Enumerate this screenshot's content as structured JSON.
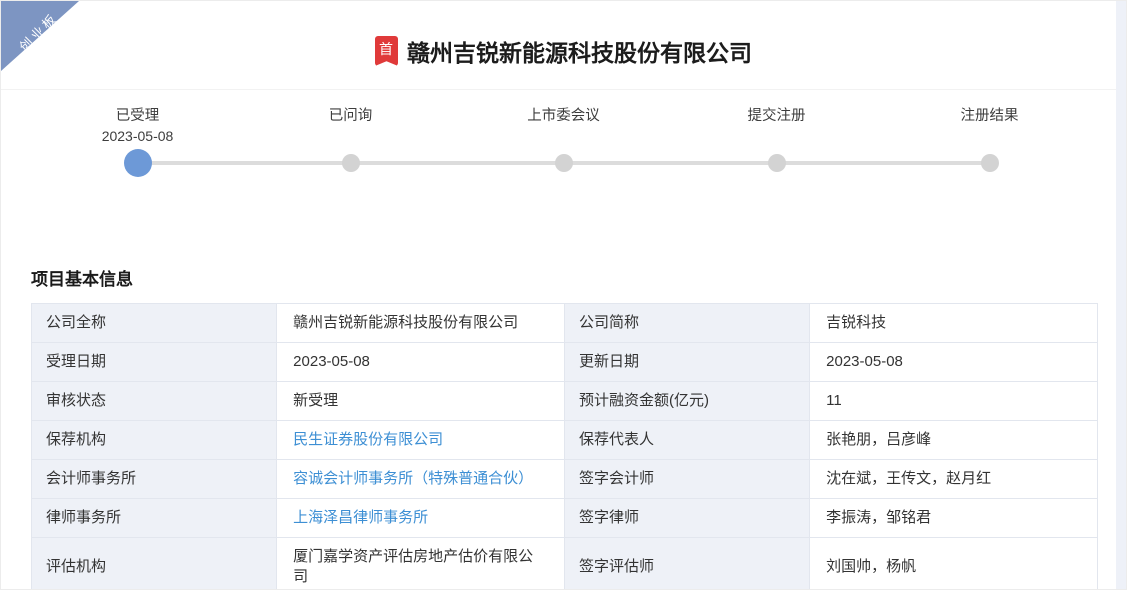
{
  "ribbon": {
    "label": "创业板",
    "color": "#7d95c2"
  },
  "header": {
    "badge_label": "首",
    "badge_color": "#e03a3a",
    "title": "赣州吉锐新能源科技股份有限公司"
  },
  "timeline": {
    "active_color": "#6d99d7",
    "inactive_color": "#d3d3d3",
    "steps": [
      {
        "label": "已受理",
        "date": "2023-05-08",
        "active": true
      },
      {
        "label": "已问询",
        "date": "",
        "active": false
      },
      {
        "label": "上市委会议",
        "date": "",
        "active": false
      },
      {
        "label": "提交注册",
        "date": "",
        "active": false
      },
      {
        "label": "注册结果",
        "date": "",
        "active": false
      }
    ]
  },
  "section": {
    "title": "项目基本信息"
  },
  "info_table": {
    "link_color": "#3d8fd4",
    "rows": [
      {
        "label1": "公司全称",
        "value1": "赣州吉锐新能源科技股份有限公司",
        "link1": false,
        "label2": "公司简称",
        "value2": "吉锐科技"
      },
      {
        "label1": "受理日期",
        "value1": "2023-05-08",
        "link1": false,
        "label2": "更新日期",
        "value2": "2023-05-08"
      },
      {
        "label1": "审核状态",
        "value1": "新受理",
        "link1": false,
        "label2": "预计融资金额(亿元)",
        "value2": "11"
      },
      {
        "label1": "保荐机构",
        "value1": "民生证券股份有限公司",
        "link1": true,
        "label2": "保荐代表人",
        "value2": "张艳朋，吕彦峰"
      },
      {
        "label1": "会计师事务所",
        "value1": "容诚会计师事务所（特殊普通合伙）",
        "link1": true,
        "label2": "签字会计师",
        "value2": "沈在斌，王传文，赵月红"
      },
      {
        "label1": "律师事务所",
        "value1": "上海泽昌律师事务所",
        "link1": true,
        "label2": "签字律师",
        "value2": "李振涛，邹铭君"
      },
      {
        "label1": "评估机构",
        "value1": "厦门嘉学资产评估房地产估价有限公司",
        "link1": false,
        "label2": "签字评估师",
        "value2": "刘国帅，杨帆"
      }
    ]
  }
}
